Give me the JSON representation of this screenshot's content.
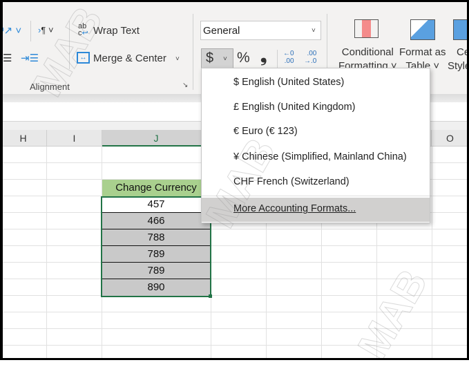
{
  "ribbon": {
    "wrap_text": "Wrap Text",
    "merge_center": "Merge & Center",
    "group_alignment": "Alignment",
    "number_format": "General",
    "currency_symbol": "$",
    "percent": "%",
    "comma": "❟",
    "increase_decimal": "←0\n.00",
    "decrease_decimal": ".00\n→.0",
    "conditional_formatting": [
      "Conditional",
      "Formatting ˅"
    ],
    "format_as_table": [
      "Format as",
      "Table ˅"
    ],
    "cell_styles": [
      "Ce",
      "Style"
    ]
  },
  "columns": [
    "H",
    "I",
    "J",
    "O"
  ],
  "table": {
    "header": "Change Currency",
    "values": [
      "457",
      "466",
      "788",
      "789",
      "789",
      "890"
    ]
  },
  "currency_menu": {
    "items": [
      "$ English (United States)",
      "£ English (United Kingdom)",
      "€ Euro (€ 123)",
      "¥ Chinese (Simplified, Mainland China)",
      "CHF French (Switzerland)"
    ],
    "more": "More Accounting Formats..."
  },
  "watermark": "MAB",
  "colors": {
    "header_fill": "#a9d08e",
    "selection": "#217346",
    "selected_fill": "#c9c9c9"
  }
}
